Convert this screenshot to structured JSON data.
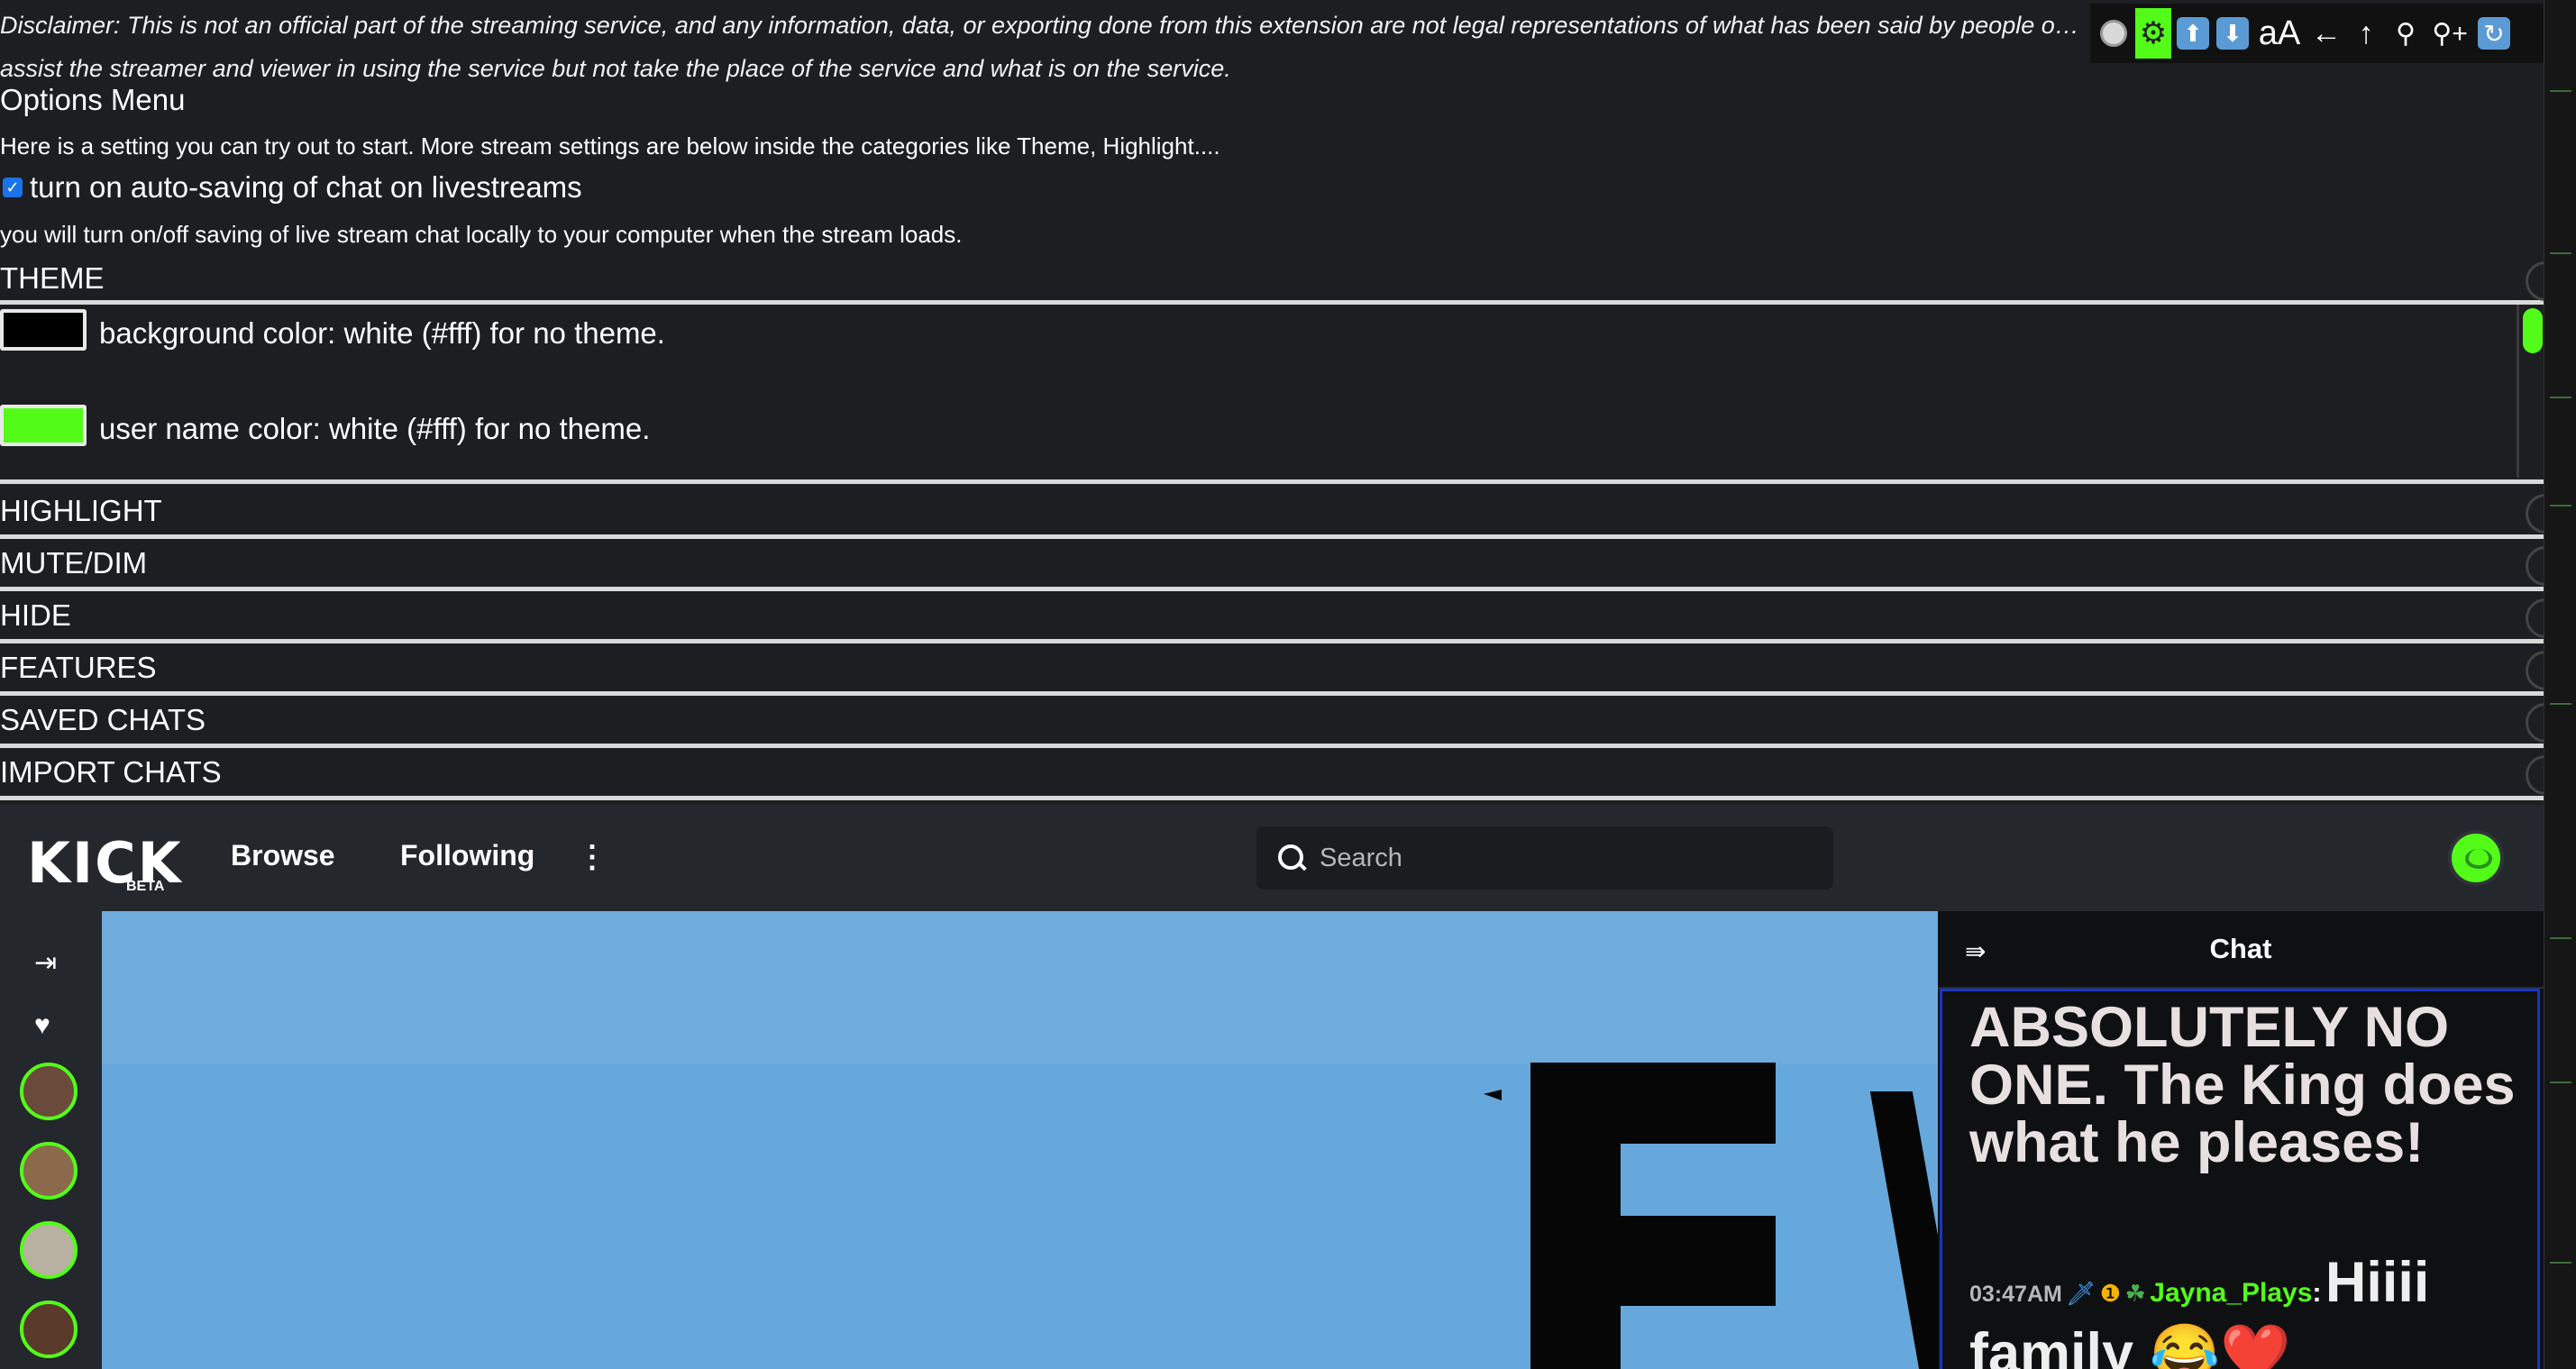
{
  "extension": {
    "disclaimer": "Disclaimer: This is not an official part of the streaming service, and any information, data, or exporting done from this extension are not legal representations of what has been said by people o… assist the streamer and viewer in using the service but not take the place of the service and what is on the service.",
    "menu_title": "Options Menu",
    "intro": "Here is a setting you can try out to start. More stream settings are below inside the categories like Theme, Highlight....",
    "autosave_label": "turn on auto-saving of chat on livestreams",
    "autosave_checked": true,
    "autosave_description": "you will turn on/off saving of live stream chat locally to your computer when the stream loads.",
    "sections": [
      "THEME",
      "HIGHLIGHT",
      "MUTE/DIM",
      "HIDE",
      "FEATURES",
      "SAVED CHATS",
      "IMPORT CHATS"
    ],
    "theme": {
      "background_color_label": "background color: white (#fff) for no theme.",
      "background_color_value": "#000000",
      "username_color_label": "user name color: white (#fff) for no theme.",
      "username_color_value": "#53fc18"
    },
    "toolbar": {
      "font_size_label": "aA",
      "buttons": [
        "record-circle-icon",
        "gear-icon",
        "scroll-up-icon",
        "scroll-down-icon",
        "font-size-icon",
        "back-arrow-icon",
        "up-arrow-icon",
        "zoom-out-icon",
        "zoom-in-icon",
        "reload-icon"
      ]
    }
  },
  "kick": {
    "logo": "KICK",
    "logo_badge": "BETA",
    "nav": {
      "browse": "Browse",
      "following": "Following",
      "more": "⋮"
    },
    "search": {
      "placeholder": "Search"
    },
    "chat": {
      "title": "Chat",
      "messages": [
        {
          "text": "ABSOLUTELY NO ONE. The King does what he pleases!"
        },
        {
          "time": "03:47AM",
          "username": "Jayna_Plays",
          "text": "Hiiii family 😂❤️"
        }
      ]
    }
  },
  "colors": {
    "accent": "#53fc18",
    "nav_bg": "#24272c",
    "panel_bg": "#1d1e22",
    "player_bg": "#67a8dc"
  }
}
